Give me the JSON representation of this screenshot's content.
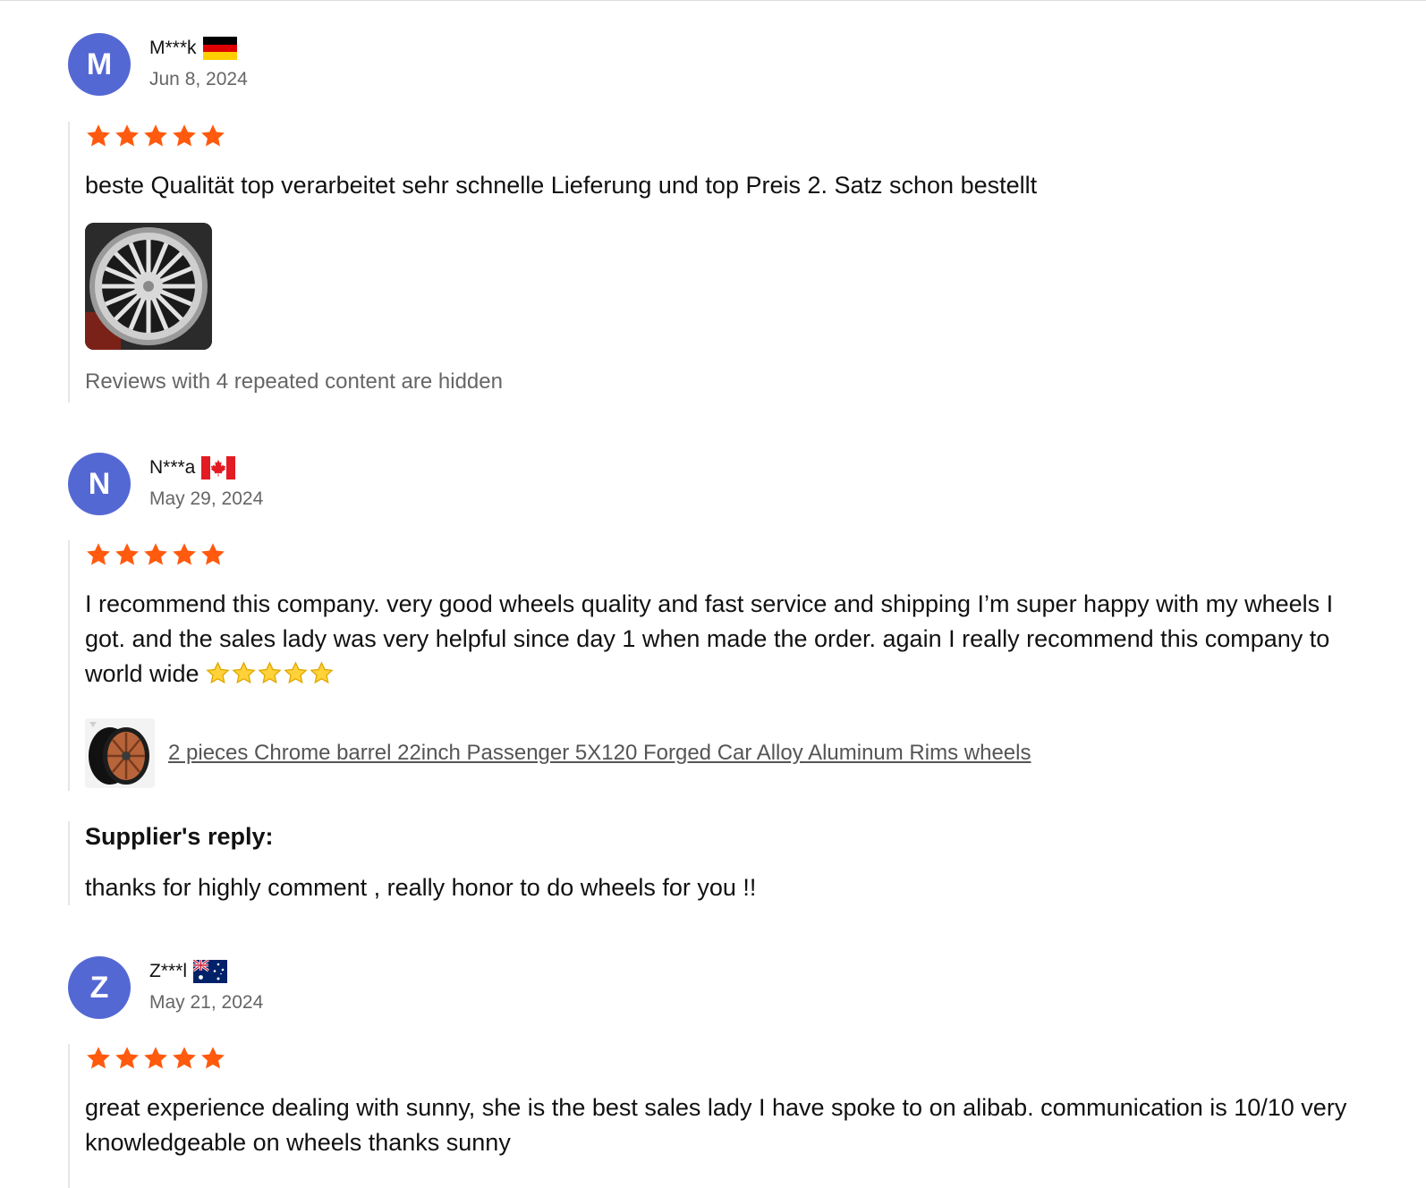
{
  "colors": {
    "avatar_bg": "#5468d4",
    "star_orange": "#ff5a0e",
    "muted_text": "#666666",
    "divider": "#e6e6e6"
  },
  "reviews": [
    {
      "avatar_initial": "M",
      "name": "M***k",
      "flag": "germany-flag-icon",
      "date": "Jun 8, 2024",
      "rating": 5,
      "text": "beste Qualität top verarbeitet sehr schnelle Lieferung und top Preis 2. Satz schon bestellt",
      "has_photo": true,
      "hidden_note": "Reviews with 4 repeated content are hidden"
    },
    {
      "avatar_initial": "N",
      "name": "N***a",
      "flag": "canada-flag-icon",
      "date": "May 29, 2024",
      "rating": 5,
      "text": "I recommend this company. very good wheels quality and fast service and shipping I’m super happy with my wheels I got. and the sales lady was very helpful since day 1 when made the order. again I really recommend this company to world wide",
      "emoji_stars": 5,
      "product_link": "2 pieces Chrome barrel 22inch Passenger 5X120 Forged Car Alloy Aluminum Rims wheels",
      "supplier_reply_title": "Supplier's reply:",
      "supplier_reply": "thanks for highly comment , really honor to do wheels for you !!"
    },
    {
      "avatar_initial": "Z",
      "name": "Z***l",
      "flag": "australia-flag-icon",
      "date": "May 21, 2024",
      "rating": 5,
      "text": "great experience dealing with sunny, she is the best sales lady I have spoke to on alibab. communication is 10/10 very knowledgeable on wheels thanks sunny"
    }
  ]
}
